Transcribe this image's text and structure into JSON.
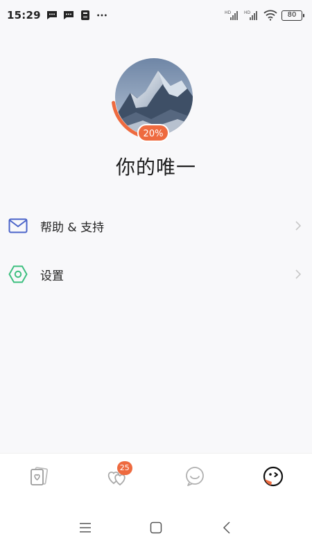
{
  "status_bar": {
    "time": "15:29",
    "battery": "80",
    "network_label_1": "HD",
    "network_label_2": "HD"
  },
  "profile": {
    "name": "你的唯一",
    "completion_percent": "20%",
    "completion_fraction": 0.2,
    "avatar_icon": "mountain-photo"
  },
  "menu": {
    "items": [
      {
        "label": "帮助 & 支持",
        "icon": "mail-icon"
      },
      {
        "label": "设置",
        "icon": "hexagon-settings-icon"
      }
    ]
  },
  "tabs": {
    "items": [
      {
        "name": "cards",
        "icon": "cards-icon"
      },
      {
        "name": "likes",
        "icon": "hearts-icon",
        "badge": "25"
      },
      {
        "name": "chat",
        "icon": "chat-bubble-icon"
      },
      {
        "name": "me",
        "icon": "face-icon"
      }
    ]
  },
  "colors": {
    "accent": "#ee6a3f",
    "mail_icon": "#4a63c9",
    "settings_icon": "#3dbf7f"
  }
}
